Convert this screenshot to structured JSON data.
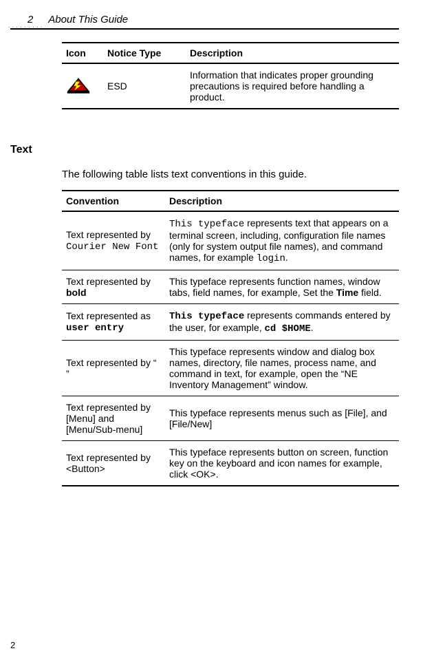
{
  "header": {
    "page_number": "2",
    "title": "About This Guide"
  },
  "table1": {
    "headers": {
      "c1": "Icon",
      "c2": "Notice Type",
      "c3": "Description"
    },
    "row": {
      "notice_type": "ESD",
      "description": "Information that indicates proper grounding precautions is required before handling a product."
    }
  },
  "section": {
    "heading": "Text",
    "intro": "The following table lists text conventions in this guide."
  },
  "table2": {
    "headers": {
      "c1": "Convention",
      "c2": "Description"
    },
    "rows": {
      "r0": {
        "conv_pre": "Text represented by ",
        "conv_mono": "Courier New Font",
        "desc_a": "This typeface",
        "desc_b": " represents text that appears on a terminal screen, including, configuration file names (only for system output file names), and command names, for example ",
        "desc_c": "login",
        "desc_d": "."
      },
      "r1": {
        "conv_pre": "Text represented by ",
        "conv_bold": "bold",
        "desc_a": "This typeface represents function names, window tabs, field names, for example, Set the ",
        "desc_b": "Time",
        "desc_c": " field."
      },
      "r2": {
        "conv_pre": "Text represented as ",
        "conv_monob": "user entry",
        "desc_a": "This typeface",
        "desc_b": " represents commands entered by the user, for example, ",
        "desc_c": "cd $HOME",
        "desc_d": "."
      },
      "r3": {
        "conv": "Text represented by “ ”",
        "desc": "This typeface represents window and dialog box names, directory, file names, process name, and command in text, for example, open the “NE Inventory Management” window."
      },
      "r4": {
        "conv": "Text represented by [Menu] and [Menu/Sub-menu]",
        "desc": "This typeface represents menus such as [File], and [File/New]"
      },
      "r5": {
        "conv": "Text represented by <Button>",
        "desc": "This typeface represents button on screen, function key on the keyboard and icon names for example, click <OK>."
      }
    }
  },
  "footer": {
    "page": "2"
  }
}
